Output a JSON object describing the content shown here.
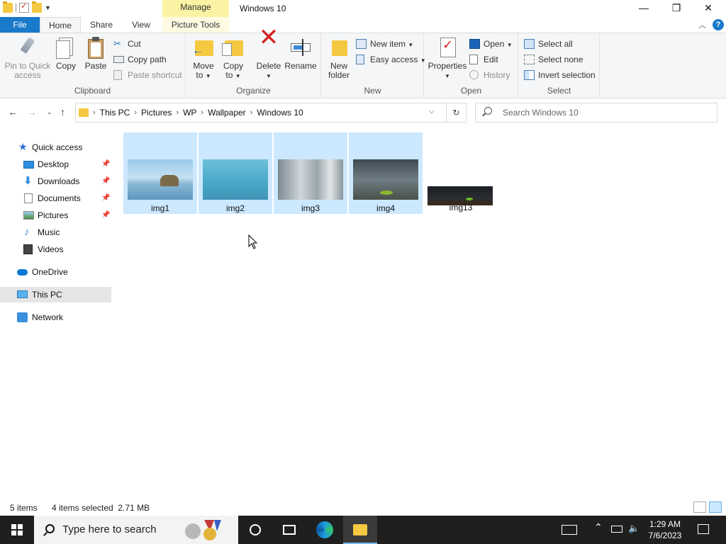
{
  "window": {
    "title": "Windows 10",
    "manage_label": "Manage",
    "minimize": "—",
    "maximize": "❐",
    "close": "✕"
  },
  "tabs": {
    "file": "File",
    "home": "Home",
    "share": "Share",
    "view": "View",
    "picture_tools": "Picture Tools",
    "collapse": "︿",
    "help": "?"
  },
  "ribbon": {
    "clipboard": {
      "label": "Clipboard",
      "pin": "Pin to Quick access",
      "pin_line1": "Pin to Quick",
      "pin_line2": "access",
      "copy": "Copy",
      "paste": "Paste",
      "cut": "Cut",
      "copy_path": "Copy path",
      "paste_shortcut": "Paste shortcut"
    },
    "organize": {
      "label": "Organize",
      "move_to_1": "Move",
      "move_to_2": "to",
      "copy_to_1": "Copy",
      "copy_to_2": "to",
      "delete": "Delete",
      "rename": "Rename"
    },
    "new": {
      "label": "New",
      "new_folder_1": "New",
      "new_folder_2": "folder",
      "new_item": "New item",
      "easy_access": "Easy access"
    },
    "open": {
      "label": "Open",
      "properties": "Properties",
      "open": "Open",
      "edit": "Edit",
      "history": "History"
    },
    "select": {
      "label": "Select",
      "select_all": "Select all",
      "select_none": "Select none",
      "invert_selection": "Invert selection"
    }
  },
  "address": {
    "crumbs": [
      "This PC",
      "Pictures",
      "WP",
      "Wallpaper",
      "Windows 10"
    ],
    "search_placeholder": "Search Windows 10"
  },
  "nav": {
    "quick_access": "Quick access",
    "items": [
      {
        "label": "Desktop",
        "icon": "desktop-icon",
        "pinned": true
      },
      {
        "label": "Downloads",
        "icon": "downloads-icon",
        "pinned": true
      },
      {
        "label": "Documents",
        "icon": "documents-icon",
        "pinned": true
      },
      {
        "label": "Pictures",
        "icon": "pictures-icon",
        "pinned": true
      },
      {
        "label": "Music",
        "icon": "music-icon",
        "pinned": false
      },
      {
        "label": "Videos",
        "icon": "videos-icon",
        "pinned": false
      }
    ],
    "onedrive": "OneDrive",
    "this_pc": "This PC",
    "network": "Network"
  },
  "files": [
    {
      "name": "img1",
      "selected": true
    },
    {
      "name": "img2",
      "selected": true
    },
    {
      "name": "img3",
      "selected": true
    },
    {
      "name": "img4",
      "selected": true
    },
    {
      "name": "img13",
      "selected": false
    }
  ],
  "status": {
    "item_count": "5 items",
    "selection": "4 items selected  2.71 MB"
  },
  "taskbar": {
    "search_placeholder": "Type here to search",
    "time": "1:29 AM",
    "date": "7/6/2023"
  },
  "colors": {
    "accent": "#1979ca",
    "selection": "#cce8ff",
    "manage_tab": "#fbf3a4",
    "taskbar": "#1f1f1f"
  }
}
